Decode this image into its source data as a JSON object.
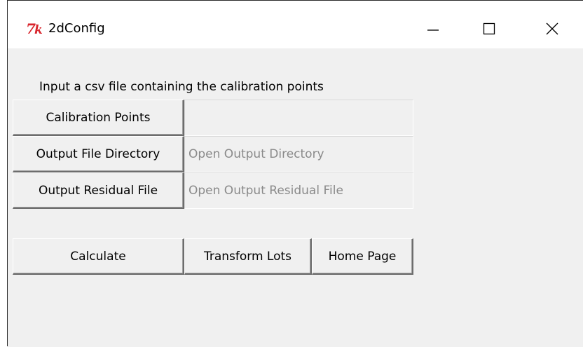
{
  "window": {
    "title": "2dConfig"
  },
  "icons": {
    "app": "tk-feather-icon",
    "minimize": "minimize-icon",
    "maximize": "maximize-icon",
    "close": "close-icon"
  },
  "colors": {
    "app_icon": "#d8252c",
    "window_bg": "#f0f0f0",
    "placeholder_text": "#8a8a8a"
  },
  "main": {
    "prompt": "Input a csv file containing the calibration points",
    "rows": [
      {
        "button_label": "Calibration Points",
        "field_value": ""
      },
      {
        "button_label": "Output File Directory",
        "field_value": "Open Output Directory"
      },
      {
        "button_label": "Output Residual File",
        "field_value": "Open Output Residual File"
      }
    ],
    "actions": {
      "calculate": "Calculate",
      "transform_lots": "Transform Lots",
      "home_page": "Home Page"
    }
  }
}
